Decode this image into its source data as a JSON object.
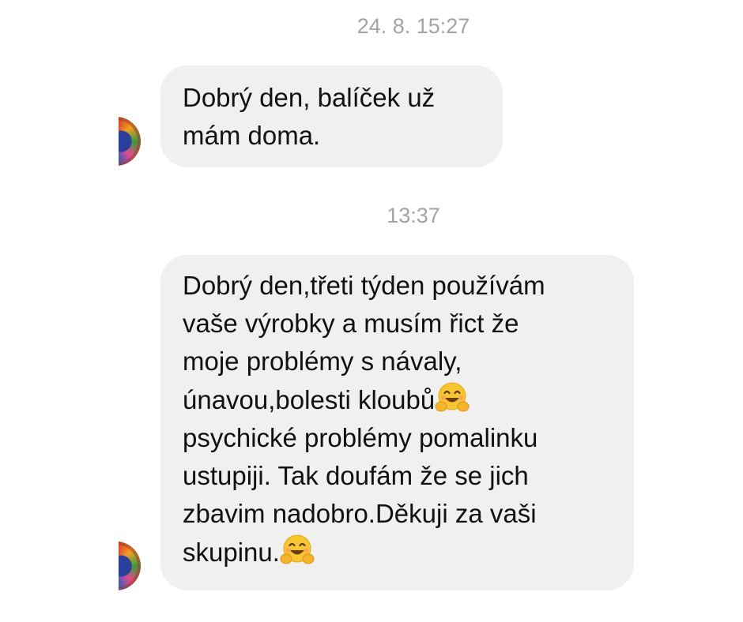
{
  "conversation": {
    "groups": [
      {
        "timestamp": "24. 8. 15:27",
        "message": {
          "lines": [
            "Dobrý den, balíček už",
            "mám doma."
          ]
        }
      },
      {
        "timestamp": "13:37",
        "message": {
          "lines": [
            "Dobrý den,třeti týden používám",
            "vaše výrobky a musím řict že",
            "moje problémy s návaly,",
            "únavou,bolesti kloubů",
            "psychické problémy pomalinku",
            "ustupiji. Tak doufám že se jich",
            "zbavim nadobro.Děkuji za vaši",
            "skupinu."
          ],
          "emoji": "hugging-face-emoji"
        }
      }
    ]
  },
  "colors": {
    "background": "#ffffff",
    "bubble": "#f0f0f0",
    "timestamp_text": "#a3a3a8",
    "message_text": "#111111"
  },
  "icons": {
    "sender_avatar": "colorful-mandala-avatar",
    "reaction_emoji": "hugging-face-emoji"
  }
}
